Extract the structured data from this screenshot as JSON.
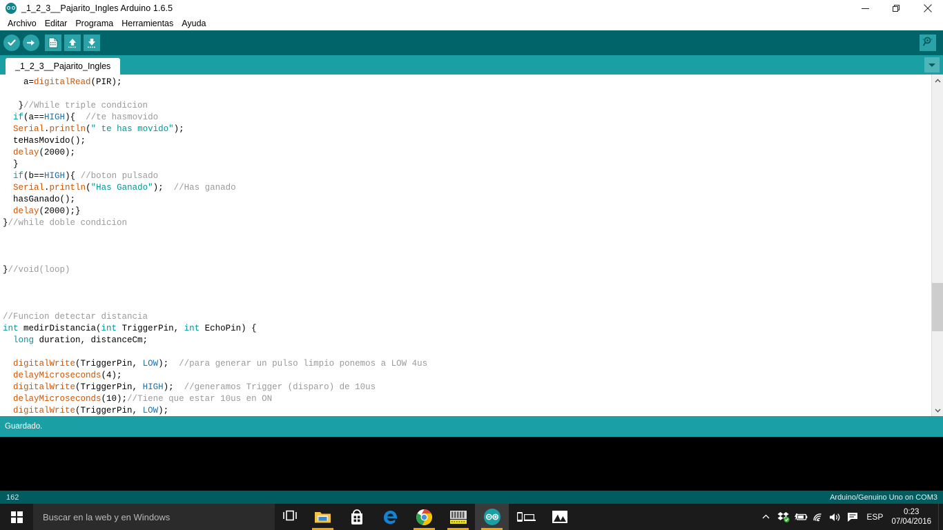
{
  "window": {
    "title": "_1_2_3__Pajarito_Ingles Arduino 1.6.5",
    "logo_icon": "arduino-logo-icon",
    "minimize_label": "Minimizar",
    "maximize_label": "Restaurar",
    "close_label": "Cerrar"
  },
  "menubar": {
    "items": [
      {
        "label": "Archivo"
      },
      {
        "label": "Editar"
      },
      {
        "label": "Programa"
      },
      {
        "label": "Herramientas"
      },
      {
        "label": "Ayuda"
      }
    ]
  },
  "toolbar": {
    "buttons": [
      {
        "name": "verify-button",
        "icon": "checkmark-icon",
        "label": "Verificar"
      },
      {
        "name": "upload-button",
        "icon": "arrow-right-icon",
        "label": "Subir"
      },
      {
        "name": "new-button",
        "icon": "new-file-icon",
        "label": "Nuevo"
      },
      {
        "name": "open-button",
        "icon": "arrow-up-icon",
        "label": "Abrir"
      },
      {
        "name": "save-button",
        "icon": "arrow-down-icon",
        "label": "Guardar"
      }
    ],
    "serial_monitor": {
      "icon": "magnifier-icon",
      "label": "Monitor Serie"
    }
  },
  "tabs": {
    "active": "_1_2_3__Pajarito_Ingles",
    "dropdown_icon": "chevron-down-icon"
  },
  "editor": {
    "lines": [
      {
        "indent": 4,
        "tokens": [
          {
            "t": "pln",
            "s": "a="
          },
          {
            "t": "fn",
            "s": "digitalRead"
          },
          {
            "t": "pln",
            "s": "(PIR);"
          }
        ]
      },
      {
        "indent": 0,
        "tokens": []
      },
      {
        "indent": 3,
        "tokens": [
          {
            "t": "pln",
            "s": "}"
          },
          {
            "t": "cmt",
            "s": "//While triple condicion"
          }
        ]
      },
      {
        "indent": 2,
        "tokens": [
          {
            "t": "kw",
            "s": "if"
          },
          {
            "t": "pln",
            "s": "(a=="
          },
          {
            "t": "lit",
            "s": "HIGH"
          },
          {
            "t": "pln",
            "s": "){  "
          },
          {
            "t": "cmt",
            "s": "//te hasmovido"
          }
        ]
      },
      {
        "indent": 2,
        "tokens": [
          {
            "t": "fn",
            "s": "Serial"
          },
          {
            "t": "pln",
            "s": "."
          },
          {
            "t": "fn",
            "s": "println"
          },
          {
            "t": "pln",
            "s": "("
          },
          {
            "t": "str",
            "s": "\" te has movido\""
          },
          {
            "t": "pln",
            "s": ");"
          }
        ]
      },
      {
        "indent": 2,
        "tokens": [
          {
            "t": "pln",
            "s": "teHasMovido();"
          }
        ]
      },
      {
        "indent": 2,
        "tokens": [
          {
            "t": "fn",
            "s": "delay"
          },
          {
            "t": "pln",
            "s": "(2000);"
          }
        ]
      },
      {
        "indent": 2,
        "tokens": [
          {
            "t": "pln",
            "s": "}"
          }
        ]
      },
      {
        "indent": 2,
        "tokens": [
          {
            "t": "kw",
            "s": "if"
          },
          {
            "t": "pln",
            "s": "(b=="
          },
          {
            "t": "lit",
            "s": "HIGH"
          },
          {
            "t": "pln",
            "s": "){ "
          },
          {
            "t": "cmt",
            "s": "//boton pulsado"
          }
        ]
      },
      {
        "indent": 2,
        "tokens": [
          {
            "t": "fn",
            "s": "Serial"
          },
          {
            "t": "pln",
            "s": "."
          },
          {
            "t": "fn",
            "s": "println"
          },
          {
            "t": "pln",
            "s": "("
          },
          {
            "t": "str",
            "s": "\"Has Ganado\""
          },
          {
            "t": "pln",
            "s": ");  "
          },
          {
            "t": "cmt",
            "s": "//Has ganado"
          }
        ]
      },
      {
        "indent": 2,
        "tokens": [
          {
            "t": "pln",
            "s": "hasGanado();"
          }
        ]
      },
      {
        "indent": 2,
        "tokens": [
          {
            "t": "fn",
            "s": "delay"
          },
          {
            "t": "pln",
            "s": "(2000);}"
          }
        ]
      },
      {
        "indent": 0,
        "tokens": [
          {
            "t": "pln",
            "s": "}"
          },
          {
            "t": "cmt",
            "s": "//while doble condicion"
          }
        ]
      },
      {
        "indent": 0,
        "tokens": []
      },
      {
        "indent": 0,
        "tokens": []
      },
      {
        "indent": 0,
        "tokens": []
      },
      {
        "indent": 0,
        "tokens": [
          {
            "t": "pln",
            "s": "}"
          },
          {
            "t": "cmt",
            "s": "//void(loop)"
          }
        ]
      },
      {
        "indent": 0,
        "tokens": []
      },
      {
        "indent": 0,
        "tokens": []
      },
      {
        "indent": 0,
        "tokens": []
      },
      {
        "indent": 0,
        "tokens": [
          {
            "t": "cmt",
            "s": "//Funcion detectar distancia"
          }
        ]
      },
      {
        "indent": 0,
        "tokens": [
          {
            "t": "kw",
            "s": "int"
          },
          {
            "t": "pln",
            "s": " medirDistancia("
          },
          {
            "t": "kw",
            "s": "int"
          },
          {
            "t": "pln",
            "s": " TriggerPin, "
          },
          {
            "t": "kw",
            "s": "int"
          },
          {
            "t": "pln",
            "s": " EchoPin) {"
          }
        ]
      },
      {
        "indent": 2,
        "tokens": [
          {
            "t": "kw",
            "s": "long"
          },
          {
            "t": "pln",
            "s": " duration, distanceCm;"
          }
        ]
      },
      {
        "indent": 0,
        "tokens": []
      },
      {
        "indent": 2,
        "tokens": [
          {
            "t": "fn",
            "s": "digitalWrite"
          },
          {
            "t": "pln",
            "s": "(TriggerPin, "
          },
          {
            "t": "lit",
            "s": "LOW"
          },
          {
            "t": "pln",
            "s": ");  "
          },
          {
            "t": "cmt",
            "s": "//para generar un pulso limpio ponemos a LOW 4us"
          }
        ]
      },
      {
        "indent": 2,
        "tokens": [
          {
            "t": "fn",
            "s": "delayMicroseconds"
          },
          {
            "t": "pln",
            "s": "(4);"
          }
        ]
      },
      {
        "indent": 2,
        "tokens": [
          {
            "t": "fn",
            "s": "digitalWrite"
          },
          {
            "t": "pln",
            "s": "(TriggerPin, "
          },
          {
            "t": "lit",
            "s": "HIGH"
          },
          {
            "t": "pln",
            "s": ");  "
          },
          {
            "t": "cmt",
            "s": "//generamos Trigger (disparo) de 10us"
          }
        ]
      },
      {
        "indent": 2,
        "tokens": [
          {
            "t": "fn",
            "s": "delayMicroseconds"
          },
          {
            "t": "pln",
            "s": "(10);"
          },
          {
            "t": "cmt",
            "s": "//Tiene que estar 10us en ON"
          }
        ]
      },
      {
        "indent": 2,
        "tokens": [
          {
            "t": "fn",
            "s": "digitalWrite"
          },
          {
            "t": "pln",
            "s": "(TriggerPin, "
          },
          {
            "t": "lit",
            "s": "LOW"
          },
          {
            "t": "pln",
            "s": ");"
          }
        ]
      }
    ],
    "scrollbar": {
      "up_icon": "chevron-up-icon",
      "down_icon": "chevron-down-icon"
    }
  },
  "status": {
    "message": "Guardado."
  },
  "console": {
    "text": ""
  },
  "infobar": {
    "line_number": "162",
    "board": "Arduino/Genuino Uno on COM3"
  },
  "taskbar": {
    "start_icon": "windows-logo-icon",
    "search_placeholder": "Buscar en la web y en Windows",
    "task_view_icon": "task-view-icon",
    "apps": [
      {
        "name": "file-explorer-icon",
        "label": "Explorador de archivos",
        "active": false,
        "running": true
      },
      {
        "name": "microsoft-store-icon",
        "label": "Tienda",
        "active": false,
        "running": false
      },
      {
        "name": "microsoft-edge-icon",
        "label": "Microsoft Edge",
        "active": false,
        "running": false
      },
      {
        "name": "google-chrome-icon",
        "label": "Google Chrome",
        "active": false,
        "running": true
      },
      {
        "name": "fritzing-icon",
        "label": "Fritzing",
        "active": false,
        "running": true
      },
      {
        "name": "arduino-icon",
        "label": "Arduino",
        "active": true,
        "running": true
      },
      {
        "name": "connect-device-icon",
        "label": "Conectar",
        "active": false,
        "running": false
      },
      {
        "name": "photos-icon",
        "label": "Fotos",
        "active": false,
        "running": false
      }
    ],
    "tray": [
      {
        "name": "show-hidden-icons-icon",
        "label": "Mostrar iconos ocultos"
      },
      {
        "name": "dropbox-icon",
        "label": "Dropbox"
      },
      {
        "name": "battery-icon",
        "label": "Bateria"
      },
      {
        "name": "wifi-icon",
        "label": "Red"
      },
      {
        "name": "volume-icon",
        "label": "Volumen"
      },
      {
        "name": "action-center-icon",
        "label": "Centro de actividades"
      }
    ],
    "language": "ESP",
    "time": "0:23",
    "date": "07/04/2016"
  },
  "colors": {
    "arduino_teal": "#1a9fa4",
    "arduino_dark_teal": "#006468",
    "arduino_darker": "#005c5f",
    "keyword": "#00979c",
    "function": "#d35400",
    "literal": "#1f6fa8",
    "comment": "#9a9a9a",
    "taskbar_accent": "#f0a30a"
  }
}
